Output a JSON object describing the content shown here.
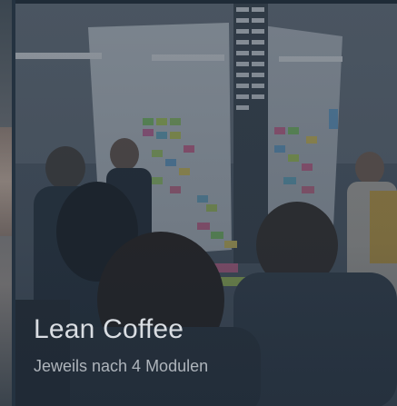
{
  "card": {
    "title": "Lean Coffee",
    "subtitle": "Jeweils nach 4 Modulen",
    "image_description_icon": "photo-workshop-icon"
  },
  "colors": {
    "overlay": "#182432",
    "title_text": "#d9dde2",
    "subtitle_text": "#aeb4bb"
  }
}
